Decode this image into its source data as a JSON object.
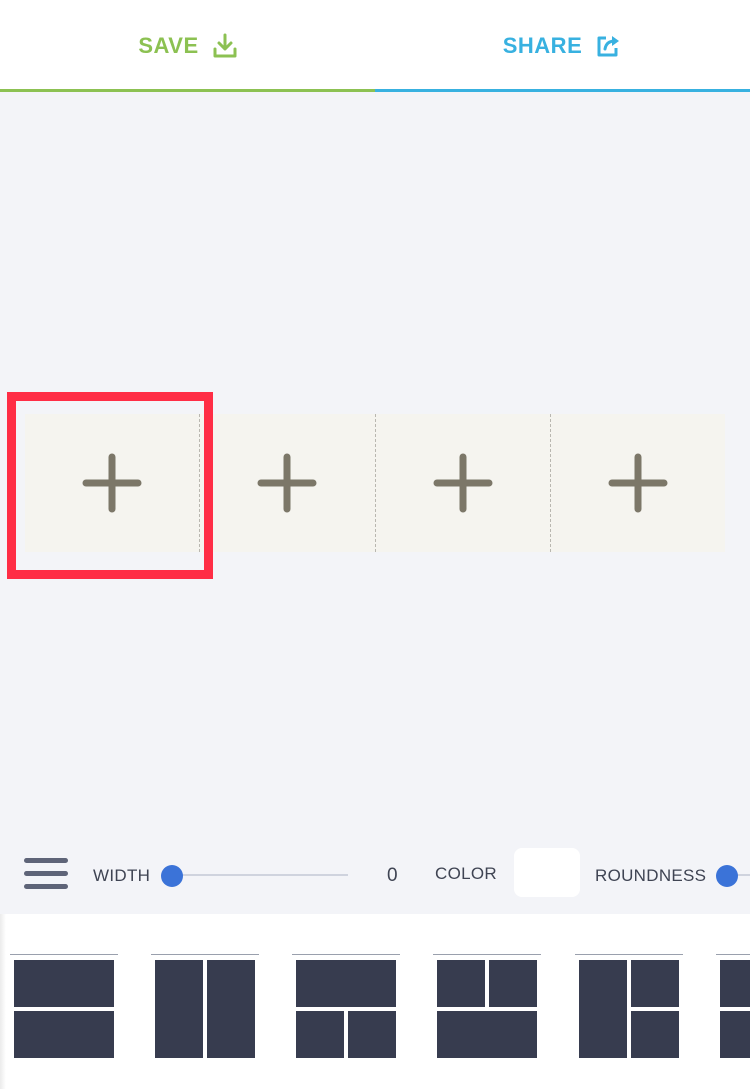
{
  "topbar": {
    "save": {
      "label": "SAVE",
      "icon": "download-icon",
      "color": "#8cc152"
    },
    "share": {
      "label": "SHARE",
      "icon": "share-icon",
      "color": "#38b1e0"
    }
  },
  "collage": {
    "cells": [
      {
        "icon": "plus-icon",
        "selected": true
      },
      {
        "icon": "plus-icon",
        "selected": false
      },
      {
        "icon": "plus-icon",
        "selected": false
      },
      {
        "icon": "plus-icon",
        "selected": false
      }
    ],
    "selection_color": "#ff2d45",
    "cell_color": "#f5f4ef",
    "plus_color": "#7c7768"
  },
  "controls": {
    "menu_icon": "hamburger-menu-icon",
    "width_label": "WIDTH",
    "width_value": "0",
    "color_label": "COLOR",
    "color_value": "#ffffff",
    "roundness_label": "ROUNDNESS",
    "slider_color": "#3b73d8"
  },
  "layouts": [
    {
      "name": "two-rows"
    },
    {
      "name": "two-columns"
    },
    {
      "name": "one-top-two-bottom"
    },
    {
      "name": "two-top-one-bottom"
    },
    {
      "name": "one-left-two-right"
    },
    {
      "name": "partial-next-layout"
    }
  ]
}
